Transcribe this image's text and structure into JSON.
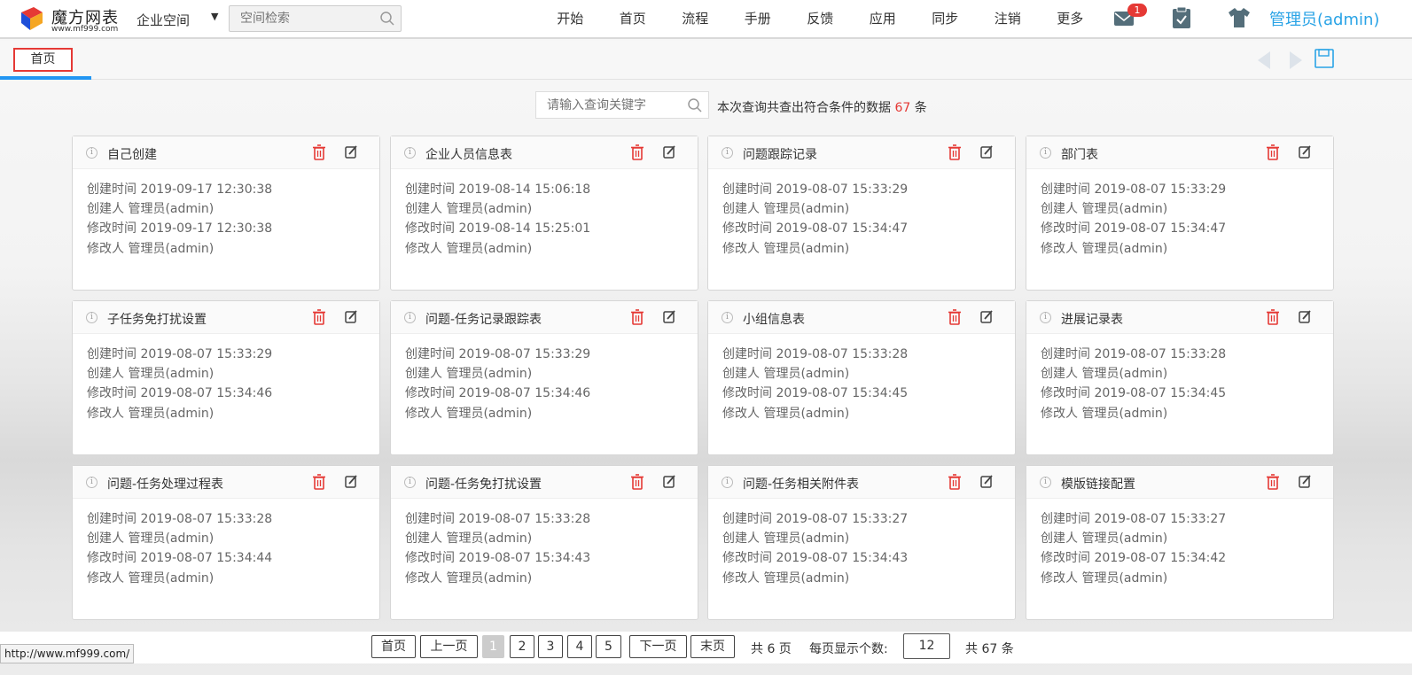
{
  "header": {
    "logo_title": "魔方网表",
    "logo_sub": "www.mf999.com",
    "space_select": "企业空间",
    "space_search_placeholder": "空间检索",
    "nav": [
      "开始",
      "首页",
      "流程",
      "手册",
      "反馈",
      "应用",
      "同步",
      "注销",
      "更多"
    ],
    "mail_badge": "1",
    "user": "管理员(admin)"
  },
  "tabs": {
    "active": "首页"
  },
  "query": {
    "placeholder": "请输入查询关键字",
    "prefix": "本次查询共查出符合条件的数据",
    "count": "67",
    "suffix": "条"
  },
  "cards": [
    {
      "title": "自己创建",
      "created": "创建时间 2019-09-17 12:30:38",
      "creator": "创建人 管理员(admin)",
      "modified": "修改时间 2019-09-17 12:30:38",
      "modifier": "修改人 管理员(admin)"
    },
    {
      "title": "企业人员信息表",
      "created": "创建时间 2019-08-14 15:06:18",
      "creator": "创建人 管理员(admin)",
      "modified": "修改时间 2019-08-14 15:25:01",
      "modifier": "修改人 管理员(admin)"
    },
    {
      "title": "问题跟踪记录",
      "created": "创建时间 2019-08-07 15:33:29",
      "creator": "创建人 管理员(admin)",
      "modified": "修改时间 2019-08-07 15:34:47",
      "modifier": "修改人 管理员(admin)"
    },
    {
      "title": "部门表",
      "created": "创建时间 2019-08-07 15:33:29",
      "creator": "创建人 管理员(admin)",
      "modified": "修改时间 2019-08-07 15:34:47",
      "modifier": "修改人 管理员(admin)"
    },
    {
      "title": "子任务免打扰设置",
      "created": "创建时间 2019-08-07 15:33:29",
      "creator": "创建人 管理员(admin)",
      "modified": "修改时间 2019-08-07 15:34:46",
      "modifier": "修改人 管理员(admin)"
    },
    {
      "title": "问题-任务记录跟踪表",
      "created": "创建时间 2019-08-07 15:33:29",
      "creator": "创建人 管理员(admin)",
      "modified": "修改时间 2019-08-07 15:34:46",
      "modifier": "修改人 管理员(admin)"
    },
    {
      "title": "小组信息表",
      "created": "创建时间 2019-08-07 15:33:28",
      "creator": "创建人 管理员(admin)",
      "modified": "修改时间 2019-08-07 15:34:45",
      "modifier": "修改人 管理员(admin)"
    },
    {
      "title": "进展记录表",
      "created": "创建时间 2019-08-07 15:33:28",
      "creator": "创建人 管理员(admin)",
      "modified": "修改时间 2019-08-07 15:34:45",
      "modifier": "修改人 管理员(admin)"
    },
    {
      "title": "问题-任务处理过程表",
      "created": "创建时间 2019-08-07 15:33:28",
      "creator": "创建人 管理员(admin)",
      "modified": "修改时间 2019-08-07 15:34:44",
      "modifier": "修改人 管理员(admin)"
    },
    {
      "title": "问题-任务免打扰设置",
      "created": "创建时间 2019-08-07 15:33:28",
      "creator": "创建人 管理员(admin)",
      "modified": "修改时间 2019-08-07 15:34:43",
      "modifier": "修改人 管理员(admin)"
    },
    {
      "title": "问题-任务相关附件表",
      "created": "创建时间 2019-08-07 15:33:27",
      "creator": "创建人 管理员(admin)",
      "modified": "修改时间 2019-08-07 15:34:43",
      "modifier": "修改人 管理员(admin)"
    },
    {
      "title": "模版链接配置",
      "created": "创建时间 2019-08-07 15:33:27",
      "creator": "创建人 管理员(admin)",
      "modified": "修改时间 2019-08-07 15:34:42",
      "modifier": "修改人 管理员(admin)"
    }
  ],
  "pager": {
    "first": "首页",
    "prev": "上一页",
    "pages": [
      "1",
      "2",
      "3",
      "4",
      "5"
    ],
    "current": "1",
    "next": "下一页",
    "last": "末页",
    "total_pages": "共 6 页",
    "per_page_label": "每页显示个数:",
    "per_page": "12",
    "total": "共 67 条"
  },
  "status_url": "http://www.mf999.com/",
  "colors": {
    "accent": "#29a3e6",
    "danger": "#e53935",
    "tab_line": "#2196f3"
  }
}
